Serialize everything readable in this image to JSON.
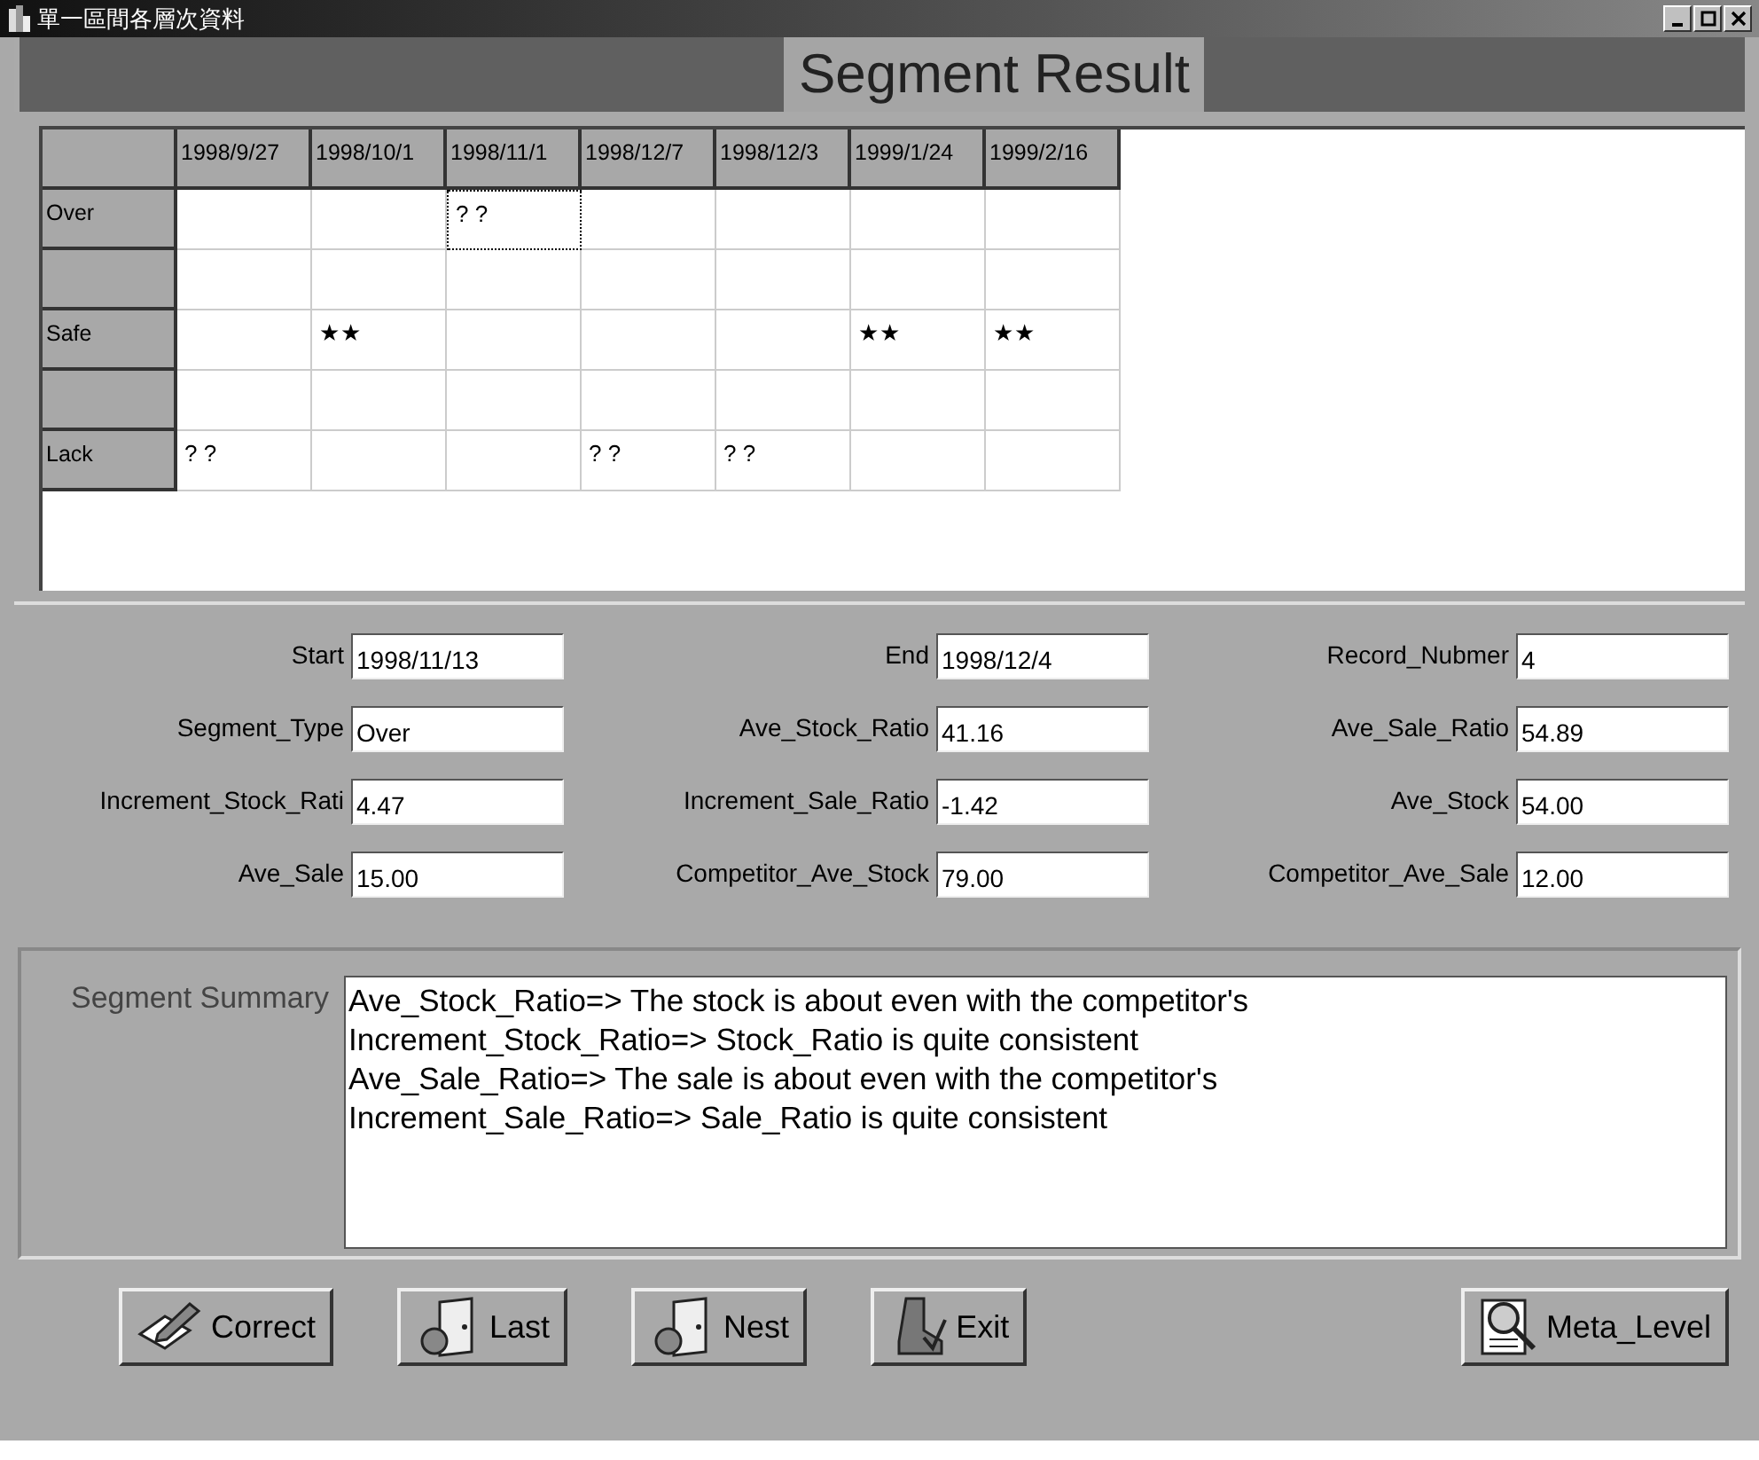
{
  "window": {
    "title": "單一區間各層次資料"
  },
  "heading": "Segment Result",
  "grid": {
    "columns": [
      "1998/9/27",
      "1998/10/1",
      "1998/11/1",
      "1998/12/7",
      "1998/12/3",
      "1999/1/24",
      "1999/2/16"
    ],
    "rows": [
      {
        "label": "Over",
        "cells": [
          {
            "selected": false
          },
          {
            "selected": false
          },
          {
            "text": "? ?",
            "selected": true
          },
          {
            "selected": false
          },
          {
            "selected": false
          },
          {
            "selected": false
          },
          {
            "selected": false
          }
        ]
      },
      {
        "cells": [
          {
            "selected": false
          },
          {
            "selected": false
          },
          {
            "selected": false
          },
          {
            "selected": false
          },
          {
            "selected": false
          },
          {
            "selected": false
          },
          {
            "selected": false
          }
        ]
      },
      {
        "label": "Safe",
        "cells": [
          {
            "selected": false
          },
          {
            "text": "★★",
            "selected": false
          },
          {
            "selected": false
          },
          {
            "selected": false
          },
          {
            "selected": false
          },
          {
            "text": "★★",
            "selected": false
          },
          {
            "text": "★★",
            "selected": false
          }
        ]
      },
      {
        "cells": [
          {
            "selected": false
          },
          {
            "selected": false
          },
          {
            "selected": false
          },
          {
            "selected": false
          },
          {
            "selected": false
          },
          {
            "selected": false
          },
          {
            "selected": false
          }
        ]
      },
      {
        "label": "Lack",
        "cells": [
          {
            "text": "? ?",
            "selected": false
          },
          {
            "selected": false
          },
          {
            "selected": false
          },
          {
            "text": "? ?",
            "selected": false
          },
          {
            "text": "? ?",
            "selected": false
          },
          {
            "selected": false
          },
          {
            "selected": false
          }
        ]
      }
    ]
  },
  "fields": [
    {
      "label": "Start",
      "value": "1998/11/13"
    },
    {
      "label": "End",
      "value": "1998/12/4"
    },
    {
      "label": "Record_Nubmer",
      "value": "4"
    },
    {
      "label": "Segment_Type",
      "value": "Over"
    },
    {
      "label": "Ave_Stock_Ratio",
      "value": "41.16"
    },
    {
      "label": "Ave_Sale_Ratio",
      "value": "54.89"
    },
    {
      "label": "Increment_Stock_Rati",
      "value": "4.47"
    },
    {
      "label": "Increment_Sale_Ratio",
      "value": "-1.42"
    },
    {
      "label": "Ave_Stock",
      "value": "54.00"
    },
    {
      "label": "Ave_Sale",
      "value": "15.00"
    },
    {
      "label": "Competitor_Ave_Stock",
      "value": "79.00"
    },
    {
      "label": "Competitor_Ave_Sale",
      "value": "12.00"
    }
  ],
  "summary": {
    "label": "Segment Summary",
    "lines": [
      "Ave_Stock_Ratio=> The stock is about even with the competitor's",
      "Increment_Stock_Ratio=> Stock_Ratio is quite consistent",
      "Ave_Sale_Ratio=> The sale is about even with the competitor's",
      "Increment_Sale_Ratio=> Sale_Ratio is quite consistent"
    ]
  },
  "buttons": [
    {
      "label": "Correct",
      "kind": "pencil"
    },
    {
      "label": "Last",
      "kind": "door"
    },
    {
      "label": "Nest",
      "kind": "door"
    },
    {
      "label": "Exit",
      "kind": "boot"
    },
    {
      "label": "Meta_Level",
      "kind": "magnifier"
    }
  ]
}
